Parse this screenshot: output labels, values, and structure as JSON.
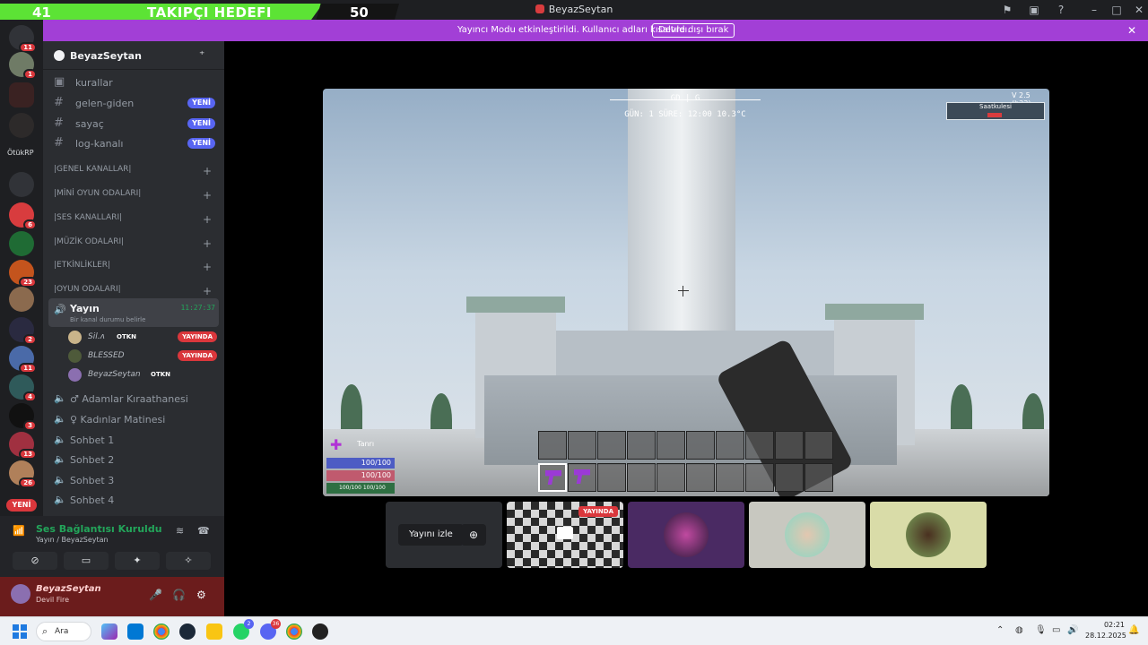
{
  "overlay": {
    "goal_start": "41",
    "goal_label": "TAKIPÇI HEDEFI",
    "goal_end": "50",
    "goal_progress": 0.82
  },
  "window": {
    "title": "BeyazSeytan"
  },
  "notice": {
    "message": "Yayıncı Modu etkinleştirildi. Kullanıcı adları kısaltıldı.",
    "button": "Devre dışı bırak"
  },
  "servers": {
    "label": "ÖtükRP",
    "new_pill": "YENİ",
    "badges": [
      "11",
      "1",
      "6",
      "23",
      "2",
      "11",
      "4",
      "3",
      "13",
      "26"
    ]
  },
  "guild": {
    "name": "BeyazSeytan"
  },
  "text_channels": [
    {
      "label": "kurallar",
      "pill": ""
    },
    {
      "label": "gelen-giden",
      "pill": "YENİ"
    },
    {
      "label": "sayaç",
      "pill": "YENİ"
    },
    {
      "label": "log-kanalı",
      "pill": "YENİ"
    }
  ],
  "categories": [
    "|GENEL KANALLAR|",
    "|MİNİ OYUN ODALARI|",
    "|SES KANALLARI|",
    "|MÜZİK ODALARI|",
    "|ETKİNLİKLER|",
    "|OYUN ODALARI|"
  ],
  "active_voice": {
    "label": "Yayın",
    "status": "Bir kanal durumu belirle",
    "time": "11:27:37"
  },
  "voice_users": [
    {
      "name": "Sil.ᴧ",
      "tag": "OTKN",
      "live": "YAYINDA"
    },
    {
      "name": "BLESSED",
      "tag": "",
      "live": "YAYINDA"
    },
    {
      "name": "BeyazSeytan",
      "tag": "OTKN",
      "live": ""
    }
  ],
  "voice_channels": [
    "♂ Adamlar Kıraathanesi",
    "♀ Kadınlar Matinesi",
    "Sohbet 1",
    "Sohbet 2",
    "Sohbet 3",
    "Sohbet 4"
  ],
  "voice_panel": {
    "title": "Ses Bağlantısı Kuruldu",
    "sub": "Yayın / BeyazSeytan"
  },
  "user": {
    "name": "BeyazSeytan",
    "status": "Devil Fire"
  },
  "game_hud": {
    "compass": "GD  |  G",
    "stats": "GÜN: 1  SÜRE: 12:00  10.3°C",
    "version": "V 2.5 (b23)",
    "zone": "Saatkulesi",
    "player_name": "Tanrı",
    "health": "100/100",
    "stamina": "100/100",
    "mini_a": "100/100",
    "mini_b": "100/100"
  },
  "tiles": {
    "watch_label": "Yayını izle",
    "live_label": "YAYINDA"
  },
  "taskbar": {
    "search": "Ara",
    "time": "02:21",
    "date": "28.12.2025",
    "discord_badge": "36",
    "whatsapp_badge": "2"
  },
  "colors": {
    "notice": "#a23fd6",
    "goal_green": "#5ce335",
    "live": "#da373c",
    "accent": "#5865f2",
    "connected": "#23a55a"
  }
}
